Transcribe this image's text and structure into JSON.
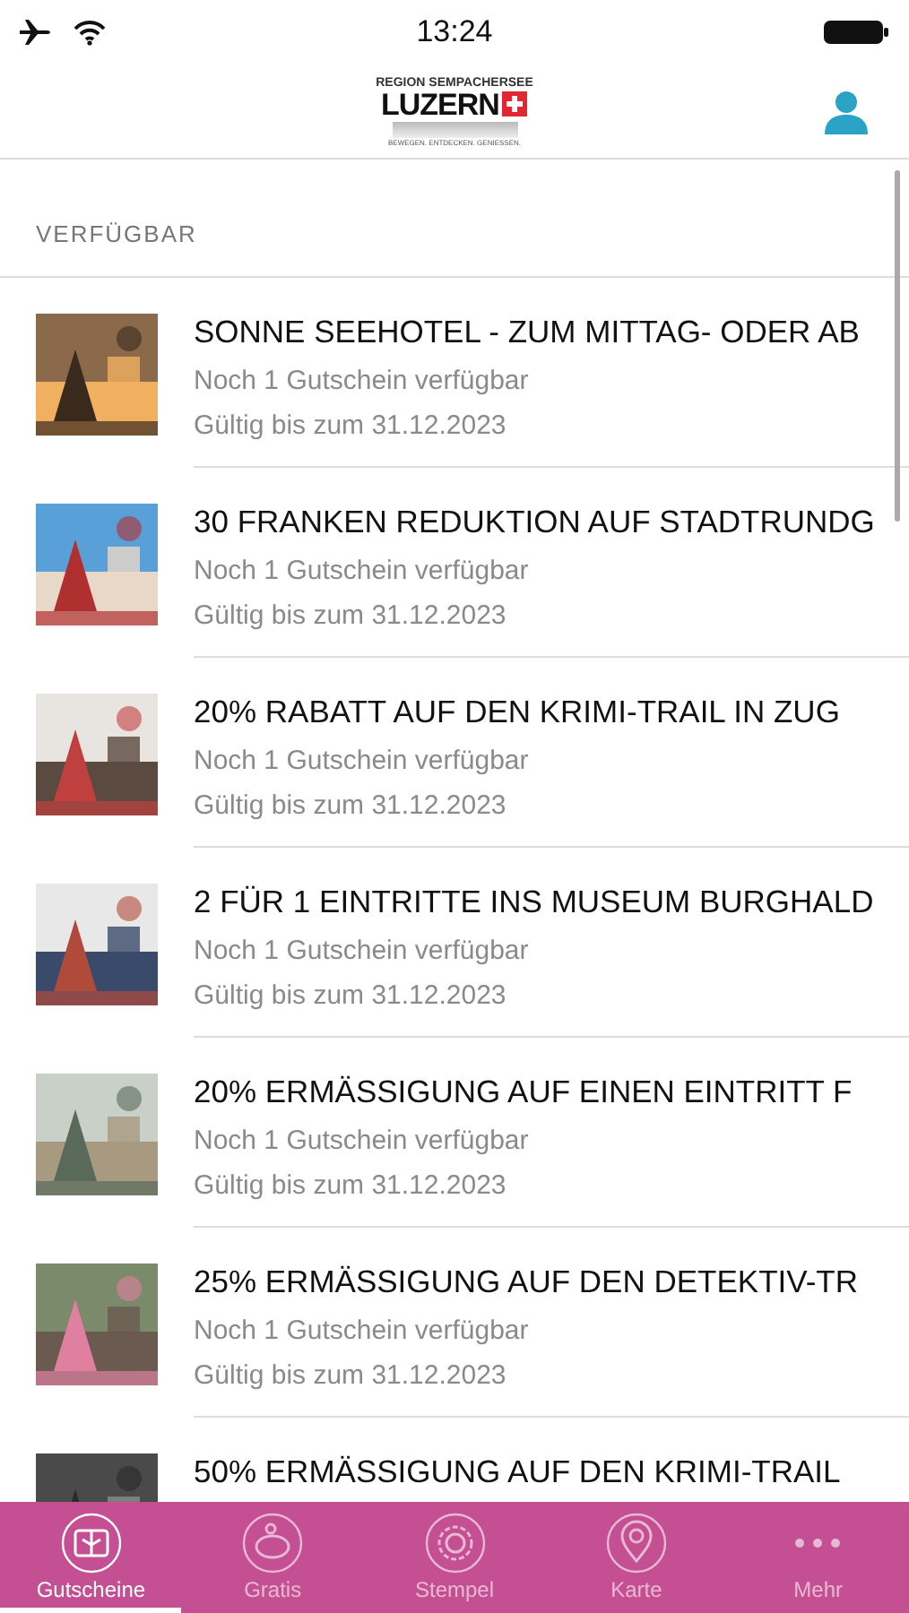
{
  "status_bar": {
    "time": "13:24"
  },
  "header": {
    "logo": {
      "region": "REGION SEMPACHERSEE",
      "name": "LUZERN",
      "tagline": "BEWEGEN. ENTDECKEN. GENIESSEN."
    }
  },
  "section": {
    "title": "VERFÜGBAR"
  },
  "vouchers": [
    {
      "title": "SONNE SEEHOTEL - ZUM MITTAG- ODER AB",
      "availability": "Noch 1 Gutschein verfügbar",
      "validity": "Gültig bis zum 31.12.2023"
    },
    {
      "title": "30 FRANKEN REDUKTION AUF STADTRUNDG",
      "availability": "Noch 1 Gutschein verfügbar",
      "validity": "Gültig bis zum 31.12.2023"
    },
    {
      "title": "20% RABATT AUF DEN KRIMI-TRAIL IN ZUG",
      "availability": "Noch 1 Gutschein verfügbar",
      "validity": "Gültig bis zum 31.12.2023"
    },
    {
      "title": "2 FÜR 1 EINTRITTE INS MUSEUM BURGHALD",
      "availability": "Noch 1 Gutschein verfügbar",
      "validity": "Gültig bis zum 31.12.2023"
    },
    {
      "title": "20% ERMÄSSIGUNG AUF EINEN EINTRITT F",
      "availability": "Noch 1 Gutschein verfügbar",
      "validity": "Gültig bis zum 31.12.2023"
    },
    {
      "title": "25% ERMÄSSIGUNG AUF DEN DETEKTIV-TR",
      "availability": "Noch 1 Gutschein verfügbar",
      "validity": "Gültig bis zum 31.12.2023"
    },
    {
      "title": "50% ERMÄSSIGUNG AUF DEN KRIMI-TRAIL"
    }
  ],
  "tabs": [
    {
      "label": "Gutscheine",
      "kind": "voucher",
      "selected": true
    },
    {
      "label": "Gratis",
      "kind": "piggy",
      "selected": false
    },
    {
      "label": "Stempel",
      "kind": "stamp",
      "selected": false
    },
    {
      "label": "Karte",
      "kind": "pin",
      "selected": false
    },
    {
      "label": "Mehr",
      "kind": "more",
      "selected": false
    }
  ]
}
